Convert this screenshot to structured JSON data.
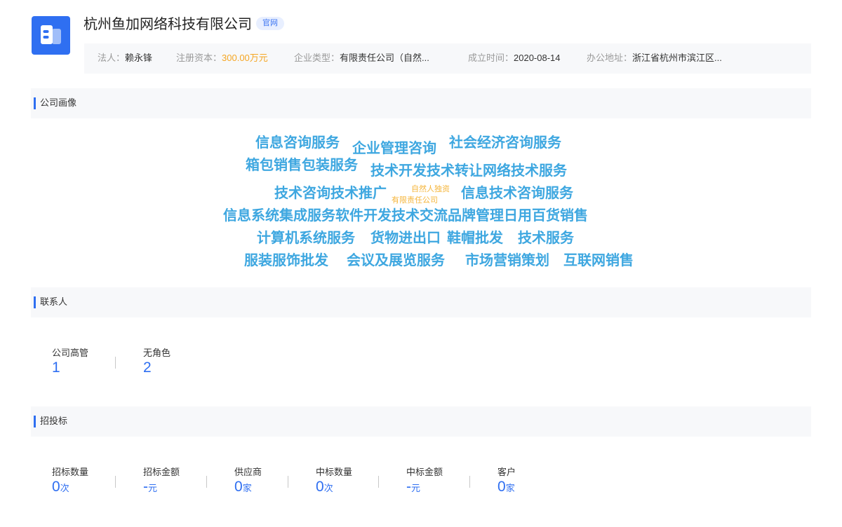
{
  "company": {
    "name": "杭州鱼加网络科技有限公司",
    "official_tag": "官网",
    "logo_icon": "building-icon",
    "info": [
      {
        "label": "法人：",
        "value": "赖永锋",
        "highlight": false
      },
      {
        "label": "注册资本：",
        "value": "300.00万元",
        "highlight": true
      },
      {
        "label": "企业类型：",
        "value": "有限责任公司（自然...",
        "highlight": false
      },
      {
        "label": "成立时间：",
        "value": "2020-08-14",
        "highlight": false
      },
      {
        "label": "办公地址：",
        "value": "浙江省杭州市滨江区...",
        "highlight": false
      }
    ]
  },
  "sections": {
    "profile": "公司画像",
    "contacts": "联系人",
    "bidding": "招投标"
  },
  "word_cloud": [
    "信息咨询服务",
    "企业管理咨询",
    "社会经济咨询服务",
    "箱包销售",
    "包装服务",
    "技术开发",
    "技术转让",
    "网络技术服务",
    "技术咨询",
    "技术推广",
    "自然人独资",
    "有限责任公司",
    "信息技术咨询服务",
    "信息系统集成服务",
    "软件开发",
    "技术交流",
    "品牌管理",
    "日用百货销售",
    "计算机系统服务",
    "货物进出口",
    "鞋帽批发",
    "技术服务",
    "服装服饰批发",
    "会议及展览服务",
    "市场营销策划",
    "互联网销售"
  ],
  "contacts": [
    {
      "label": "公司高管",
      "value": "1"
    },
    {
      "label": "无角色",
      "value": "2"
    }
  ],
  "bidding": [
    {
      "label": "招标数量",
      "value": "0",
      "unit": "次"
    },
    {
      "label": "招标金额",
      "value": "-",
      "unit": "元"
    },
    {
      "label": "供应商",
      "value": "0",
      "unit": "家"
    },
    {
      "label": "中标数量",
      "value": "0",
      "unit": "次"
    },
    {
      "label": "中标金额",
      "value": "-",
      "unit": "元"
    },
    {
      "label": "客户",
      "value": "0",
      "unit": "家"
    }
  ]
}
